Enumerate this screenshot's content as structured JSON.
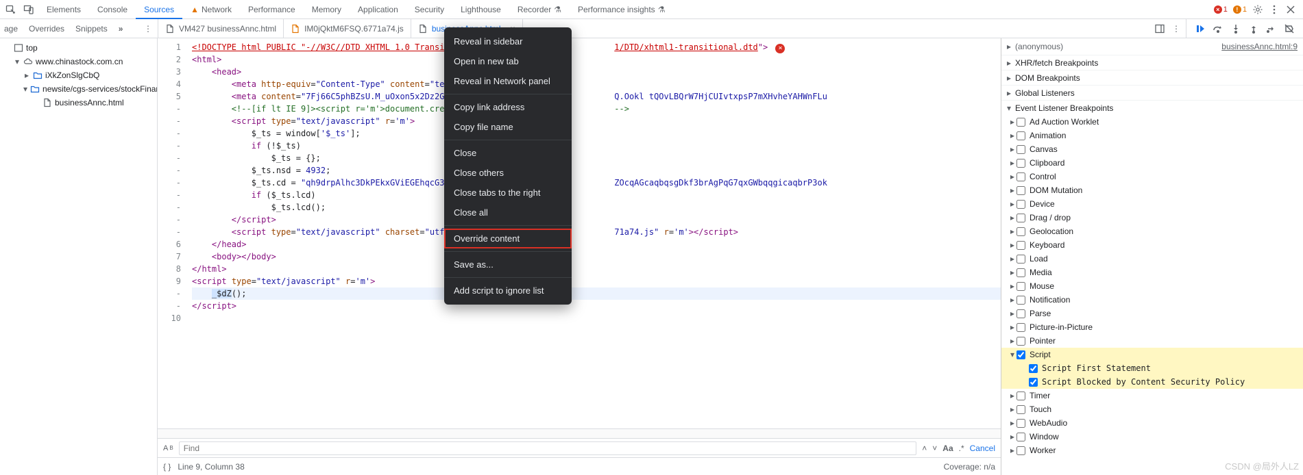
{
  "topbar": {
    "tabs": [
      "Elements",
      "Console",
      "Sources",
      "Network",
      "Performance",
      "Memory",
      "Application",
      "Security",
      "Lighthouse",
      "Recorder",
      "Performance insights"
    ],
    "active": "Sources",
    "warningTab": "Network",
    "errorsCount": "1",
    "warningsCount": "1"
  },
  "secondbar": {
    "left": [
      "age",
      "Overrides",
      "Snippets"
    ]
  },
  "fileTabs": {
    "items": [
      {
        "label": "VM427 businessAnnc.html",
        "variant": "plain"
      },
      {
        "label": "IM0jQktM6FSQ.6771a74.js",
        "variant": "orange"
      },
      {
        "label": "businessAnnc.html",
        "variant": "active"
      }
    ]
  },
  "debugger": {
    "icons": [
      "resume",
      "step-over",
      "step-into",
      "step-out",
      "step",
      "deactivate"
    ]
  },
  "sidebarTree": [
    {
      "d": 0,
      "tw": "",
      "icon": "frame",
      "label": "top"
    },
    {
      "d": 1,
      "tw": "▾",
      "icon": "cloud",
      "label": "www.chinastock.com.cn"
    },
    {
      "d": 2,
      "tw": "▸",
      "icon": "folder",
      "label": "iXkZonSlgCbQ"
    },
    {
      "d": 2,
      "tw": "▾",
      "icon": "folder",
      "label": "newsite/cgs-services/stockFinance"
    },
    {
      "d": 3,
      "tw": "",
      "icon": "file",
      "label": "businessAnnc.html"
    }
  ],
  "editor": {
    "gutter": [
      "1",
      "2",
      "3",
      "4",
      "5",
      "-",
      "-",
      "-",
      "-",
      "-",
      "-",
      "-",
      "-",
      "-",
      "-",
      "-",
      "6",
      "7",
      "8",
      "9",
      "-",
      "-",
      "10"
    ],
    "docLineTail": "1/DTD/xhtml1-transitional.dtd",
    "metaTail": "Q.Ookl tQOvLBQrW7HjCUIvtxpsP7mXHvheYAHWnFLu",
    "cdTail": "ZOcqAGcaqbqsgDkf3brAgPqG7qxGWbqqgicaqbrP3ok",
    "scriptExtTail": "71a74.js"
  },
  "findbar": {
    "placeholder": "Find",
    "aa": "Aa",
    "re": ".*",
    "cancel": "Cancel"
  },
  "statusbar": {
    "pos": "Line 9, Column 38",
    "coverage": "Coverage: n/a"
  },
  "rightPanel": {
    "anon": "(anonymous)",
    "file": "businessAnnc.html:9",
    "sections": [
      "XHR/fetch Breakpoints",
      "DOM Breakpoints",
      "Global Listeners",
      "Event Listener Breakpoints"
    ],
    "events": [
      {
        "label": "Ad Auction Worklet",
        "d": 1,
        "c": false
      },
      {
        "label": "Animation",
        "d": 1,
        "c": false
      },
      {
        "label": "Canvas",
        "d": 1,
        "c": false
      },
      {
        "label": "Clipboard",
        "d": 1,
        "c": false
      },
      {
        "label": "Control",
        "d": 1,
        "c": false
      },
      {
        "label": "DOM Mutation",
        "d": 1,
        "c": false
      },
      {
        "label": "Device",
        "d": 1,
        "c": false
      },
      {
        "label": "Drag / drop",
        "d": 1,
        "c": false
      },
      {
        "label": "Geolocation",
        "d": 1,
        "c": false
      },
      {
        "label": "Keyboard",
        "d": 1,
        "c": false
      },
      {
        "label": "Load",
        "d": 1,
        "c": false
      },
      {
        "label": "Media",
        "d": 1,
        "c": false
      },
      {
        "label": "Mouse",
        "d": 1,
        "c": false
      },
      {
        "label": "Notification",
        "d": 1,
        "c": false
      },
      {
        "label": "Parse",
        "d": 1,
        "c": false
      },
      {
        "label": "Picture-in-Picture",
        "d": 1,
        "c": false
      },
      {
        "label": "Pointer",
        "d": 1,
        "c": false
      },
      {
        "label": "Script",
        "d": 1,
        "c": true,
        "open": true,
        "hl": true
      },
      {
        "label": "Script First Statement",
        "d": 2,
        "c": true,
        "hl": true,
        "mono": true
      },
      {
        "label": "Script Blocked by Content Security Policy",
        "d": 2,
        "c": true,
        "hl": true,
        "mono": true
      },
      {
        "label": "Timer",
        "d": 1,
        "c": false
      },
      {
        "label": "Touch",
        "d": 1,
        "c": false
      },
      {
        "label": "WebAudio",
        "d": 1,
        "c": false
      },
      {
        "label": "Window",
        "d": 1,
        "c": false
      },
      {
        "label": "Worker",
        "d": 1,
        "c": false
      }
    ]
  },
  "contextMenu": {
    "items": [
      {
        "t": "Reveal in sidebar"
      },
      {
        "t": "Open in new tab"
      },
      {
        "t": "Reveal in Network panel"
      },
      {
        "sep": true
      },
      {
        "t": "Copy link address"
      },
      {
        "t": "Copy file name"
      },
      {
        "sep": true
      },
      {
        "t": "Close"
      },
      {
        "t": "Close others"
      },
      {
        "t": "Close tabs to the right"
      },
      {
        "t": "Close all"
      },
      {
        "sep": true
      },
      {
        "t": "Override content",
        "hl": true
      },
      {
        "sep": true
      },
      {
        "t": "Save as..."
      },
      {
        "sep": true
      },
      {
        "t": "Add script to ignore list"
      }
    ]
  },
  "watermark": "CSDN @局外人LZ"
}
